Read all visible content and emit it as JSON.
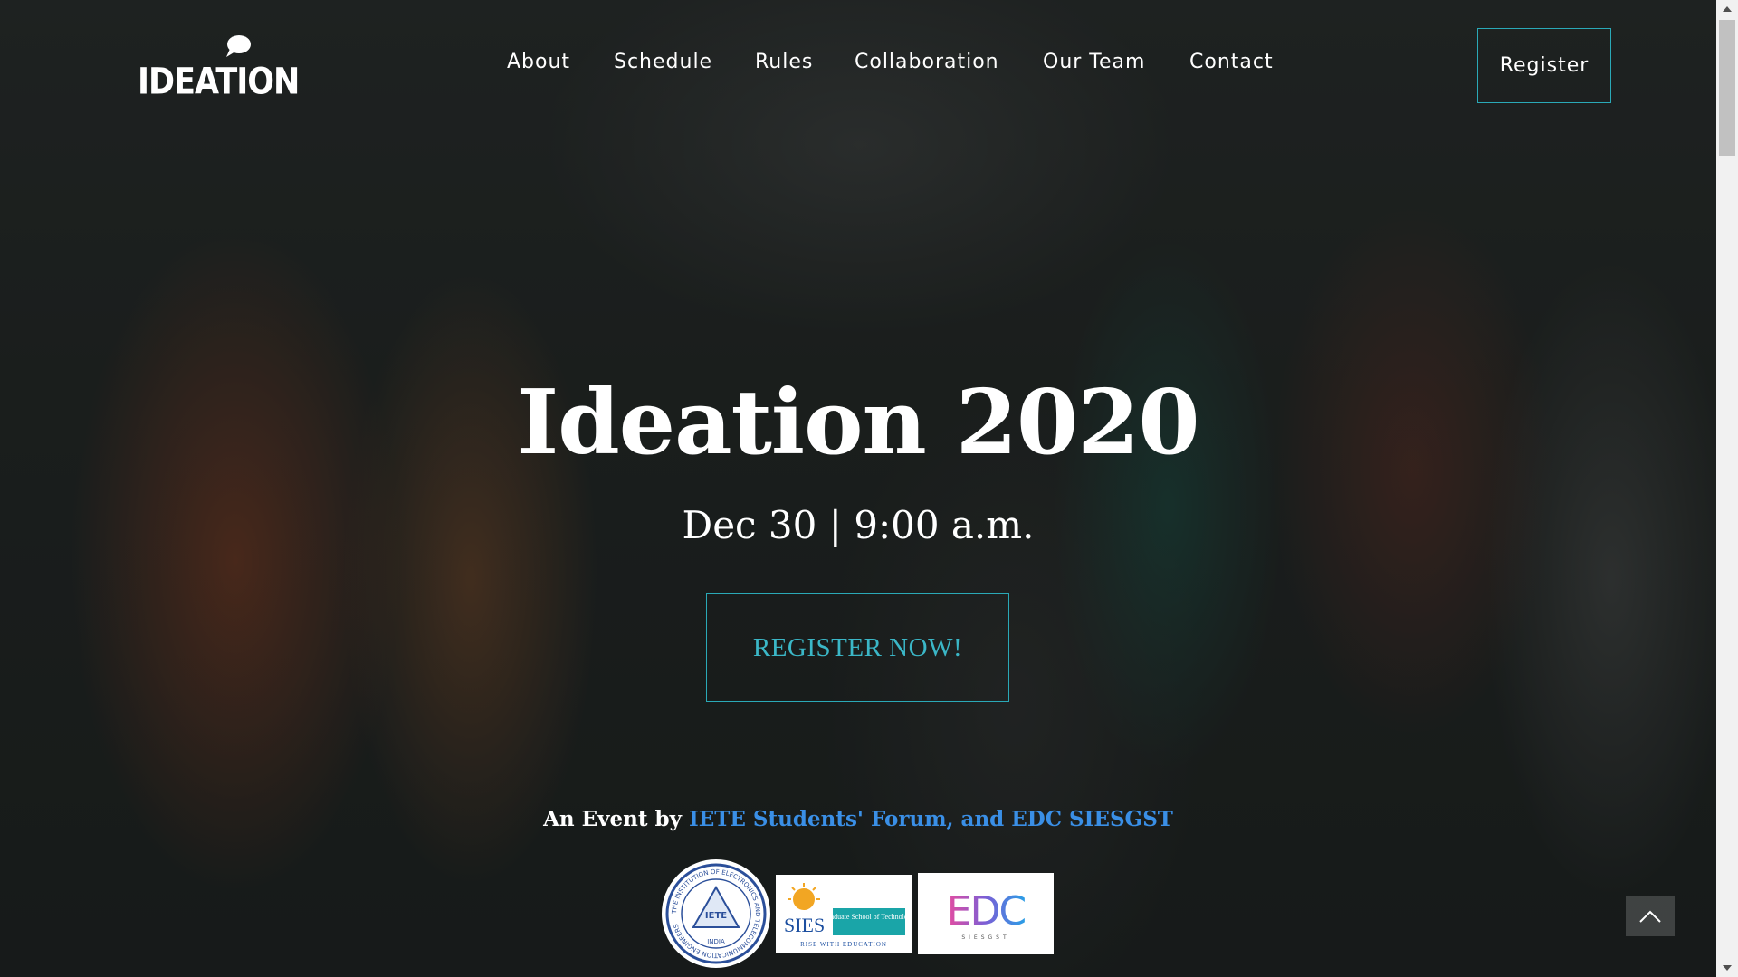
{
  "brand": {
    "logo_text": "IDEATION",
    "logo_icon": "speech-bubble-icon"
  },
  "nav": {
    "items": [
      {
        "label": "About"
      },
      {
        "label": "Schedule"
      },
      {
        "label": "Rules"
      },
      {
        "label": "Collaboration"
      },
      {
        "label": "Our Team"
      },
      {
        "label": "Contact"
      }
    ],
    "register_label": "Register"
  },
  "hero": {
    "title": "Ideation 2020",
    "date": "Dec 30 | 9:00 a.m.",
    "cta_label": "REGISTER NOW!"
  },
  "organizers": {
    "prefix": "An Event by ",
    "names": "IETE Students' Forum, and EDC SIESGST",
    "logos": [
      {
        "name": "IETE",
        "caption": "THE INSTITUTION OF ELECTRONICS AND TELECOMMUNICATION ENGINEERS",
        "sub": "INDIA"
      },
      {
        "name": "SIES",
        "caption": "Graduate School of Technology",
        "sub": "RISE WITH EDUCATION"
      },
      {
        "name": "EDC",
        "sub": "SIESGST"
      }
    ]
  },
  "colors": {
    "accent": "#2aa9b7",
    "cta_text": "#3bb7c7",
    "organizer_link": "#3a8fe6",
    "scrollbar_thumb": "#c1c1c1"
  },
  "icons": {
    "back_to_top": "chevron-up-icon",
    "scroll_up": "triangle-up-icon",
    "scroll_down": "triangle-down-icon"
  }
}
